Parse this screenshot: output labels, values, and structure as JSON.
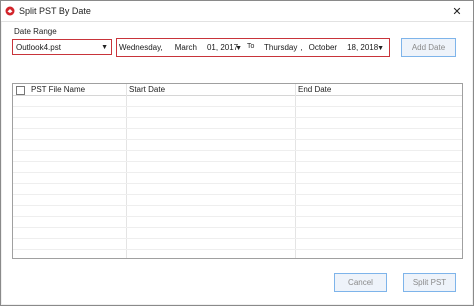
{
  "window": {
    "title": "Split PST By Date",
    "close_symbol": "✕"
  },
  "date_range": {
    "label": "Date Range",
    "pst_file": "Outlook4.pst",
    "from": {
      "weekday": "Wednesday,",
      "month": "March",
      "day_year": "01, 2017"
    },
    "to_label": "To",
    "to": {
      "weekday": "Thursday",
      "sep": ",",
      "month": "October",
      "day_year": "18, 2018"
    },
    "add_date_label": "Add Date"
  },
  "table": {
    "columns": [
      "PST File Name",
      "Start Date",
      "End Date"
    ],
    "rows": []
  },
  "footer": {
    "cancel_label": "Cancel",
    "split_label": "Split PST"
  },
  "colors": {
    "highlight_border": "#c8343a",
    "button_border": "#7eb4ea"
  }
}
